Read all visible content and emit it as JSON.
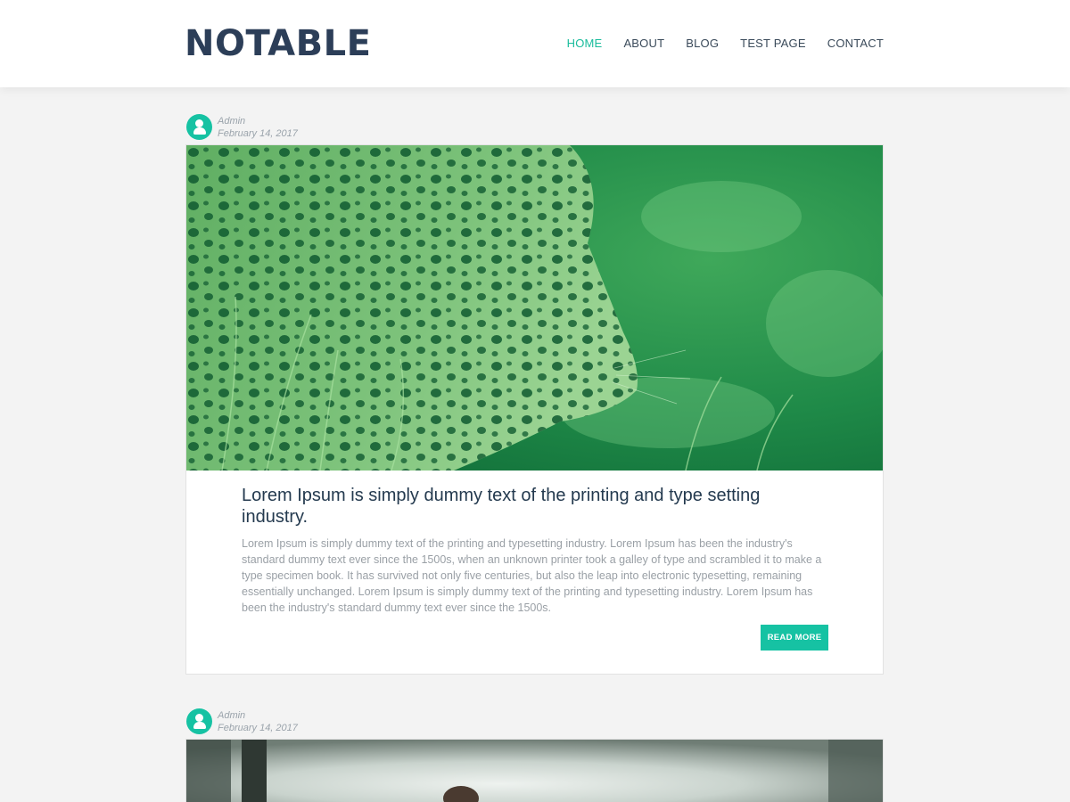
{
  "site": {
    "title": "NOTABLE",
    "nav": [
      {
        "label": "HOME",
        "active": true
      },
      {
        "label": "ABOUT",
        "active": false
      },
      {
        "label": "BLOG",
        "active": false
      },
      {
        "label": "TEST PAGE",
        "active": false
      },
      {
        "label": "CONTACT",
        "active": false
      }
    ]
  },
  "posts": [
    {
      "author": "Admin",
      "date": "February 14, 2017",
      "image_icon": "leopard-photo",
      "title": "Lorem Ipsum is simply dummy text of the printing and type setting industry.",
      "excerpt": "Lorem Ipsum is simply dummy text of the printing and typesetting industry. Lorem Ipsum has been the industry's standard dummy text ever since the 1500s, when an unknown printer took a galley of type and scrambled it to make a type specimen book. It has survived not only five centuries, but also the leap into electronic typesetting, remaining essentially unchanged. Lorem Ipsum is simply dummy text of the printing and typesetting industry. Lorem Ipsum has been the industry's standard dummy text ever since the 1500s.",
      "read_more": "READ MORE"
    },
    {
      "author": "Admin",
      "date": "February 14, 2017",
      "image_icon": "misty-forest-photo"
    }
  ],
  "colors": {
    "accent": "#16c2a3",
    "logo": "#2c3e58",
    "background": "#f3f3f3"
  }
}
